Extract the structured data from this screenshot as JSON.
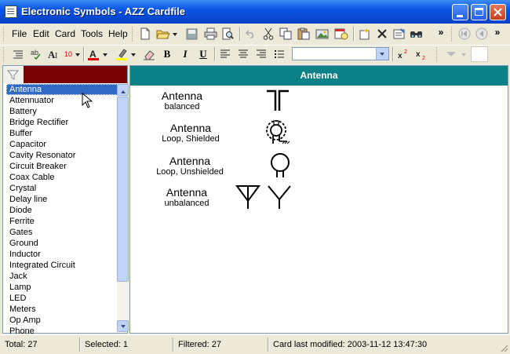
{
  "window": {
    "title": "Electronic Symbols - AZZ Cardfile"
  },
  "menu": {
    "items": [
      "File",
      "Edit",
      "Card",
      "Tools",
      "Help"
    ]
  },
  "format": {
    "font_size": "10",
    "text_color": "#e00000",
    "highlight_color": "#ffff00",
    "font_name": ""
  },
  "card": {
    "title": "Antenna",
    "header_color": "#0d8188"
  },
  "symbols": [
    {
      "name": "Antenna",
      "variant": "balanced"
    },
    {
      "name": "Antenna",
      "variant": "Loop, Shielded"
    },
    {
      "name": "Antenna",
      "variant": "Loop, Unshielded"
    },
    {
      "name": "Antenna",
      "variant": "unbalanced"
    }
  ],
  "list": {
    "items": [
      "Antenna",
      "Attennuator",
      "Battery",
      "Bridge Rectifier",
      "Buffer",
      "Capacitor",
      "Cavity Resonator",
      "Circuit Breaker",
      "Coax Cable",
      "Crystal",
      "Delay line",
      "Diode",
      "Ferrite",
      "Gates",
      "Ground",
      "Inductor",
      "Integrated Circuit",
      "Jack",
      "Lamp",
      "LED",
      "Meters",
      "Op Amp",
      "Phone"
    ],
    "selected": "Antenna"
  },
  "status": {
    "total": "Total: 27",
    "selected": "Selected: 1",
    "filtered": "Filtered: 27",
    "modified": "Card last modified: 2003-11-12  13:47:30"
  },
  "icons": [
    "app-icon",
    "minimize-icon",
    "maximize-icon",
    "close-icon",
    "new-icon",
    "open-icon",
    "save-icon",
    "print-icon",
    "print-preview-icon",
    "undo-icon",
    "cut-icon",
    "copy-icon",
    "paste-icon",
    "insert-picture-icon",
    "insert-date-icon",
    "new-card-icon",
    "delete-card-icon",
    "card-properties-icon",
    "find-icon",
    "first-card-icon",
    "previous-card-icon",
    "filter-icon"
  ]
}
